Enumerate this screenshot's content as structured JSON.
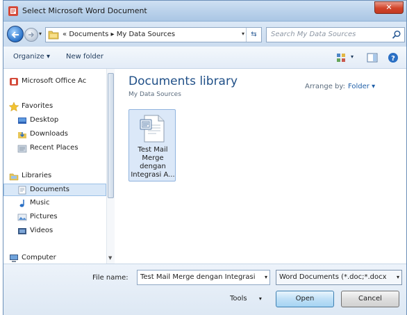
{
  "window": {
    "title": "Select Microsoft Word Document",
    "close_label": "✕"
  },
  "address": {
    "prefix": "«",
    "path": [
      "Documents",
      "My Data Sources"
    ],
    "separator": "▸",
    "search_placeholder": "Search My Data Sources"
  },
  "toolbar": {
    "organize": "Organize ▾",
    "new_folder": "New folder"
  },
  "sidebar": {
    "items": [
      {
        "label": "Microsoft Office Ac",
        "icon": "office-icon"
      },
      {
        "label": "Favorites",
        "icon": "star-icon"
      },
      {
        "label": "Desktop",
        "icon": "desktop-icon"
      },
      {
        "label": "Downloads",
        "icon": "downloads-icon"
      },
      {
        "label": "Recent Places",
        "icon": "recent-places-icon"
      },
      {
        "label": "Libraries",
        "icon": "libraries-icon"
      },
      {
        "label": "Documents",
        "icon": "documents-icon"
      },
      {
        "label": "Music",
        "icon": "music-icon"
      },
      {
        "label": "Pictures",
        "icon": "pictures-icon"
      },
      {
        "label": "Videos",
        "icon": "videos-icon"
      },
      {
        "label": "Computer",
        "icon": "computer-icon"
      }
    ]
  },
  "content": {
    "library_title": "Documents library",
    "library_subtitle": "My Data Sources",
    "arrange_label": "Arrange by:",
    "arrange_value": "Folder ▾",
    "files": [
      {
        "name": "Test Mail Merge dengan Integrasi A..."
      }
    ]
  },
  "bottom": {
    "filename_label": "File name:",
    "filename_value": "Test Mail Merge dengan Integrasi",
    "filetype_value": "Word Documents (*.doc;*.docx",
    "tools_label": "Tools",
    "open_label": "Open",
    "cancel_label": "Cancel"
  },
  "colors": {
    "accent": "#1f4f87",
    "selection": "#d9e8f8",
    "titlebar": "#b9d1ea"
  }
}
